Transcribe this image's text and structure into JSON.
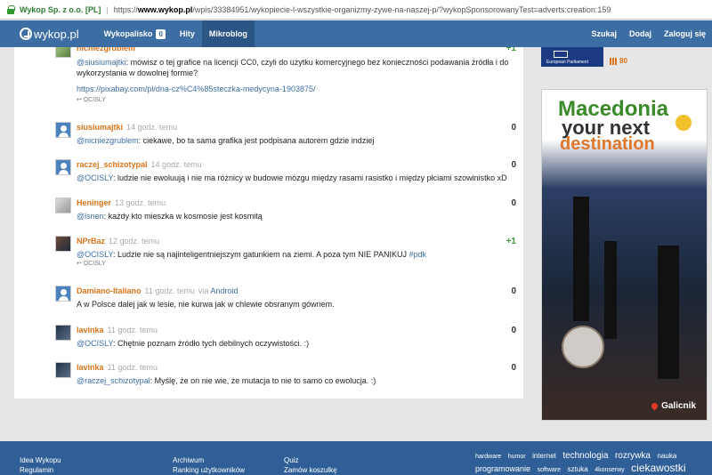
{
  "browser": {
    "site_id": "Wykop Sp. z o.o. [PL]",
    "url_prefix": "https://",
    "url_host": "www.wykop.pl",
    "url_path": "/wpis/33384951/wykopiecie-l-wszystkie-organizmy-zywe-na-naszej-p/?wykopSponsorowanyTest=adverts:creation:159"
  },
  "nav": {
    "logo": "wykop.pl",
    "items": [
      {
        "label": "Wykopalisko",
        "count": "0"
      },
      {
        "label": "Hity"
      },
      {
        "label": "Mikroblog"
      }
    ],
    "right": [
      "Szukaj",
      "Dodaj",
      "Zaloguj się"
    ]
  },
  "entries": [
    {
      "author": "nicniezgrublem",
      "time": "",
      "vote": "+1",
      "body_mention": "@siusiumajtki",
      "body_text": ": mówisz o tej grafice na licencji CC0, czyli do użytku komercyjnego bez konieczności podawania źródła i do wykorzystania w dowolnej formie?",
      "link": "https://pixabay.com/pl/dna-cz%C4%85steczka-medycyna-1903875/",
      "reply": "↩ OCISLY"
    },
    {
      "author": "siusiumajtki",
      "time": "14 godz. temu",
      "vote": "0",
      "body_mention": "@nicniezgrublem",
      "body_text": ": ciekawe, bo ta sama grafika jest podpisana autorem gdzie indziej"
    },
    {
      "author": "raczej_schizotypal",
      "time": "14 godz. temu",
      "vote": "0",
      "body_mention": "@OCISLY",
      "body_text": ": ludzie nie ewoluują i nie ma różnicy w budowie mózgu między rasami rasistko i między płciami szowinistko xD"
    },
    {
      "author": "Heninger",
      "time": "13 godz. temu",
      "vote": "0",
      "body_mention": "@lsnen",
      "body_text": ": każdy kto mieszka w kosmosie jest kosmitą"
    },
    {
      "author": "NPrBaz",
      "time": "12 godz. temu",
      "vote": "+1",
      "body_mention": "@OCISLY",
      "body_text": ": Ludzie nie są najinteligentniejszym gatunkiem na ziemi. A poza tym NIE PANIKUJ",
      "tag": "#pdk",
      "reply": "↩ OCISLY"
    },
    {
      "author": "Damiano-Italiano",
      "time": "11 godz. temu",
      "via": "via",
      "via_app": "Android",
      "vote": "0",
      "body_mention": "",
      "body_text": "A w Polsce dalej jak w lesie, nie kurwa jak w chlewie obsranym gównem."
    },
    {
      "author": "lavinka",
      "time": "11 godz. temu",
      "vote": "0",
      "body_mention": "@OCISLY",
      "body_text": ": Chętnie poznam źródło tych debilnych oczywistości. :)"
    },
    {
      "author": "lavinka",
      "time": "11 godz. temu",
      "vote": "0",
      "body_mention": "@raczej_schizotypal",
      "body_text": ": Myślę, że on nie wie, że mutacja to nie to samo co ewolucja. :)"
    }
  ],
  "sidebar": {
    "ep_label": "European Parliament",
    "score": "80",
    "ad": {
      "line1": "Macedonia",
      "line2": "your next",
      "line3": "destination",
      "place": "Galicnik"
    }
  },
  "footer": {
    "col1": [
      "Idea Wykopu",
      "Regulamin"
    ],
    "col2": [
      "Archiwum",
      "Ranking użytkowników"
    ],
    "col3": [
      "Quiz",
      "Zamów koszulkę"
    ],
    "tags": [
      "hardware",
      "humor",
      "internet",
      "technologia",
      "rozrywka",
      "nauka",
      "programowanie",
      "software",
      "sztuka",
      "4konserwy",
      "ciekawostki"
    ]
  }
}
